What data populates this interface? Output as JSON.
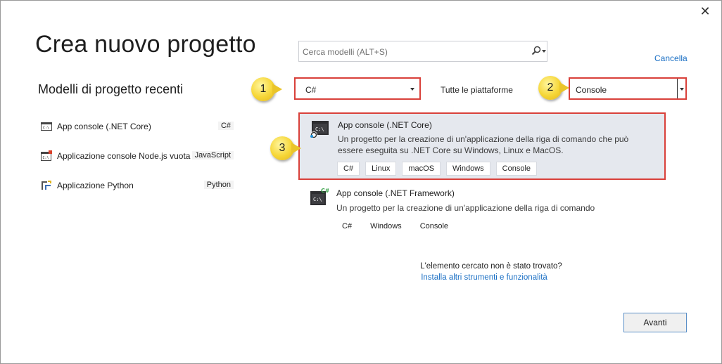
{
  "dialog": {
    "title": "Crea nuovo progetto",
    "cancel_label": "Cancella",
    "next_label": "Avanti"
  },
  "search": {
    "placeholder": "Cerca modelli (ALT+S)"
  },
  "recent": {
    "heading": "Modelli di progetto recenti",
    "items": [
      {
        "label": "App console (.NET Core)",
        "tag": "C#",
        "icon": "console-app-icon"
      },
      {
        "label": "Applicazione console Node.js vuota",
        "tag": "JavaScript",
        "icon": "nodejs-console-icon"
      },
      {
        "label": "Applicazione Python",
        "tag": "Python",
        "icon": "python-app-icon"
      }
    ]
  },
  "filters": {
    "language": "C#",
    "platform": "Tutte le piattaforme",
    "project_type": "Console"
  },
  "callouts": [
    "1",
    "2",
    "3"
  ],
  "templates": [
    {
      "name": "App console (.NET Core)",
      "description": "Un progetto per la creazione di un'applicazione della riga di comando che può essere eseguita su .NET Core su Windows, Linux e MacOS.",
      "tags": [
        "C#",
        "Linux",
        "macOS",
        "Windows",
        "Console"
      ],
      "icon": "dotnet-core-console-icon",
      "selected": true
    },
    {
      "name": "App console (.NET Framework)",
      "description": "Un progetto per la creazione di un'applicazione della riga di comando",
      "tags": [
        "C#",
        "Windows",
        "Console"
      ],
      "icon": "dotnet-framework-console-icon",
      "selected": false
    }
  ],
  "not_found": {
    "question": "L'elemento cercato non è stato trovato?",
    "link": "Installa altri strumenti e funzionalità"
  },
  "colors": {
    "highlight_border": "#d9403a",
    "selected_bg": "#e5e8ee",
    "link": "#1a6fc4",
    "callout": "#f6d636"
  }
}
